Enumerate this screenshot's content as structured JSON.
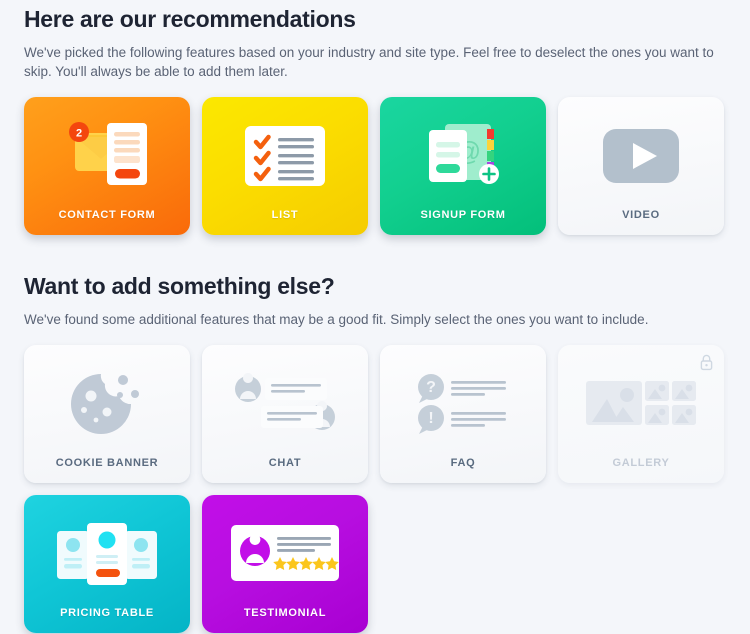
{
  "sections": [
    {
      "id": "recommendations",
      "title": "Here are our recommendations",
      "description": "We've picked the following features based on your industry and site type. Feel free to deselect the ones you want to skip. You'll always be able to add them later.",
      "cards": [
        {
          "label": "CONTACT FORM",
          "icon": "envelope-form-icon",
          "state": "selected",
          "color": "#ff9112",
          "badge": "2"
        },
        {
          "label": "LIST",
          "icon": "checklist-icon",
          "state": "selected",
          "color": "#fbdd00"
        },
        {
          "label": "SIGNUP FORM",
          "icon": "address-book-form-icon",
          "state": "selected",
          "color": "#12cf8f"
        },
        {
          "label": "VIDEO",
          "icon": "play-button-icon",
          "state": "unselected",
          "color": "#b3c0cc"
        }
      ]
    },
    {
      "id": "additional",
      "title": "Want to add something else?",
      "description": "We've found some additional features that may be a good fit. Simply select the ones you want to include.",
      "cards": [
        {
          "label": "COOKIE BANNER",
          "icon": "cookie-icon",
          "state": "unselected",
          "color": "#b9c4d0"
        },
        {
          "label": "CHAT",
          "icon": "chat-bubbles-icon",
          "state": "unselected",
          "color": "#b9c4d0"
        },
        {
          "label": "FAQ",
          "icon": "question-exclamation-bubbles-icon",
          "state": "unselected",
          "color": "#b9c4d0"
        },
        {
          "label": "GALLERY",
          "icon": "image-grid-icon",
          "state": "locked",
          "color": "#dfe5ec",
          "lock_icon": "lock-icon"
        },
        {
          "label": "PRICING TABLE",
          "icon": "pricing-cards-icon",
          "state": "selected",
          "color": "#10c6d6"
        },
        {
          "label": "TESTIMONIAL",
          "icon": "testimonial-card-icon",
          "state": "selected",
          "color": "#b70ee0"
        }
      ]
    }
  ],
  "theme": {
    "page_background": "#f4f6fa",
    "heading_color": "#1e2433",
    "body_text_color": "#5a6375",
    "unselected_label_color": "#5a6b80",
    "locked_label_color": "#c3cbd6"
  }
}
